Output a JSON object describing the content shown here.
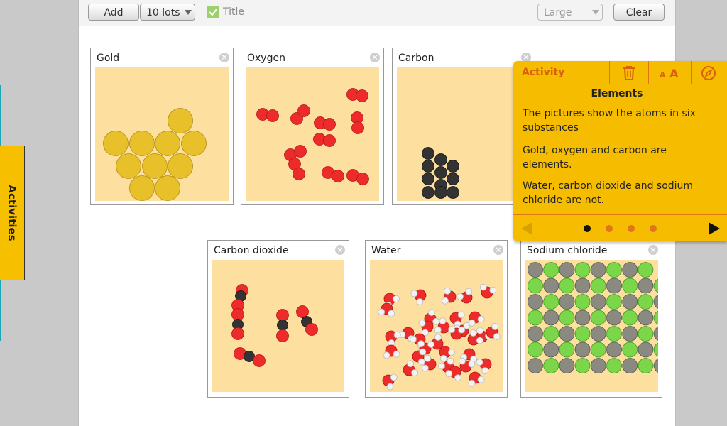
{
  "toolbar": {
    "add_label": "Add",
    "lots_label": "10 lots",
    "title_label": "Title",
    "title_checked": true,
    "size_label": "Large",
    "clear_label": "Clear"
  },
  "cards": [
    {
      "title": "Gold"
    },
    {
      "title": "Oxygen"
    },
    {
      "title": "Carbon"
    },
    {
      "title": "Carbon dioxide"
    },
    {
      "title": "Water"
    },
    {
      "title": "Sodium chloride"
    }
  ],
  "sidebar": {
    "tab_label": "Activities"
  },
  "panel": {
    "tab_label": "Activity",
    "icons": [
      "trash-icon",
      "text-size-icon",
      "compass-icon"
    ],
    "text_size_label": "AA",
    "heading": "Elements",
    "paragraphs": [
      "The pictures show the atoms in six substances",
      "Gold, oxygen and carbon are elements.",
      "Water, carbon dioxide and sodium chloride are not."
    ],
    "page_count": 4,
    "current_page": 1
  },
  "colors": {
    "panel": "#f6bd00",
    "panel_accent": "#d8600e",
    "picture_bg": "#fddfa0",
    "gold_atom": "#e8c02a",
    "oxygen_atom": "#ee2b2b",
    "carbon_atom": "#333333",
    "hydrogen_atom": "#f2f2f2",
    "sodium_atom": "#8a8a80",
    "chlorine_atom": "#7cd64a"
  }
}
